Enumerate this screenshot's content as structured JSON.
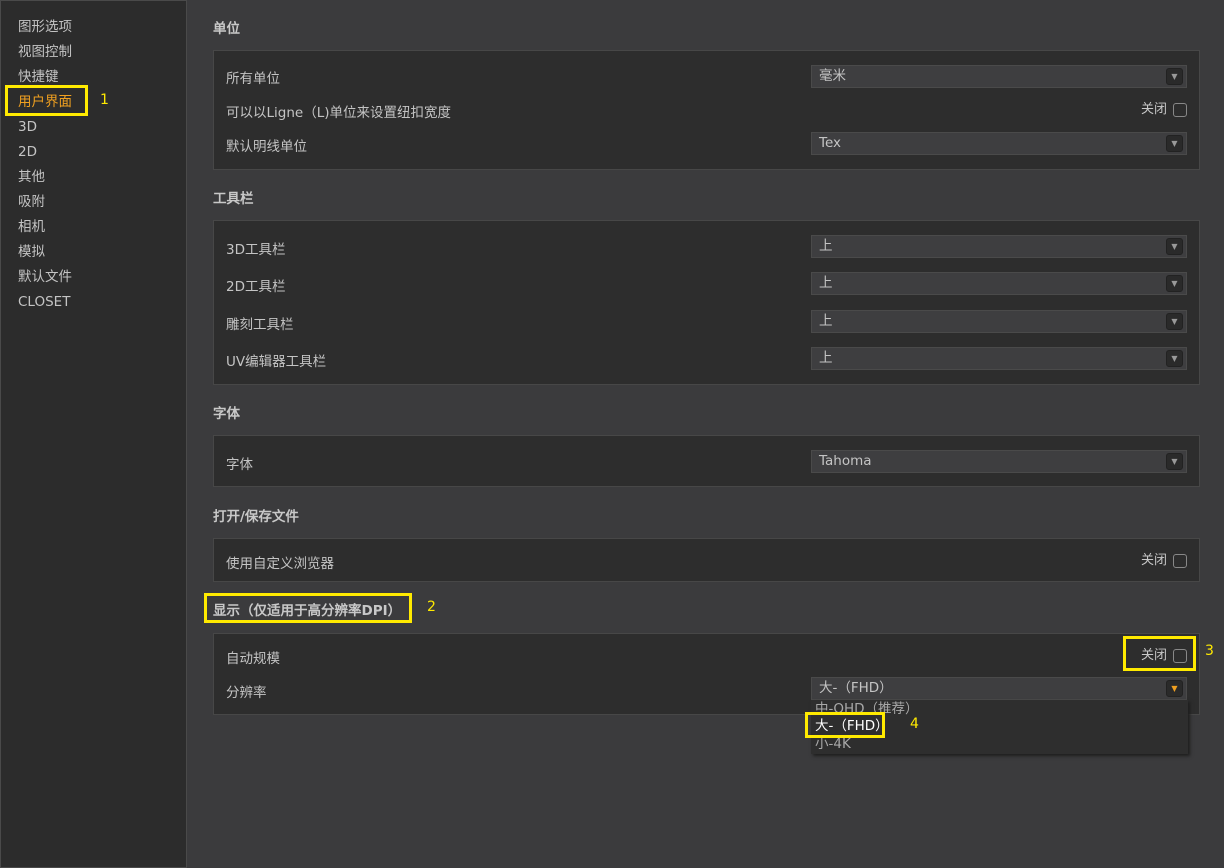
{
  "sidebar": {
    "items": [
      {
        "label": "图形选项"
      },
      {
        "label": "视图控制"
      },
      {
        "label": "快捷键"
      },
      {
        "label": "用户界面",
        "active": true
      },
      {
        "label": "3D"
      },
      {
        "label": "2D"
      },
      {
        "label": "其他"
      },
      {
        "label": "吸附"
      },
      {
        "label": "相机"
      },
      {
        "label": "模拟"
      },
      {
        "label": "默认文件"
      },
      {
        "label": "CLOSET"
      }
    ]
  },
  "sections": {
    "units": {
      "title": "单位",
      "all_units_label": "所有单位",
      "all_units_value": "毫米",
      "ligne_label": "可以以Ligne（L)单位来设置纽扣宽度",
      "ligne_toggle": "关闭",
      "thread_label": "默认明线单位",
      "thread_value": "Tex"
    },
    "toolbar": {
      "title": "工具栏",
      "rows": [
        {
          "label": "3D工具栏",
          "value": "上"
        },
        {
          "label": "2D工具栏",
          "value": "上"
        },
        {
          "label": "雕刻工具栏",
          "value": "上"
        },
        {
          "label": "UV编辑器工具栏",
          "value": "上"
        }
      ]
    },
    "font": {
      "title": "字体",
      "label": "字体",
      "value": "Tahoma"
    },
    "file": {
      "title": "打开/保存文件",
      "browser_label": "使用自定义浏览器",
      "browser_toggle": "关闭"
    },
    "display": {
      "title": "显示（仅适用于高分辨率DPI）",
      "auto_scale_label": "自动规模",
      "auto_scale_toggle": "关闭",
      "resolution_label": "分辨率",
      "resolution_value": "大-（FHD）",
      "resolution_options": [
        "中-QHD（推荐）",
        "大-（FHD）",
        "小-4K"
      ]
    }
  },
  "annotations": [
    "1",
    "2",
    "3",
    "4"
  ],
  "colors": {
    "accent": "#f0a020",
    "highlight": "#ffea00",
    "background": "#3b3b3d",
    "panel": "#2d2d2d"
  }
}
